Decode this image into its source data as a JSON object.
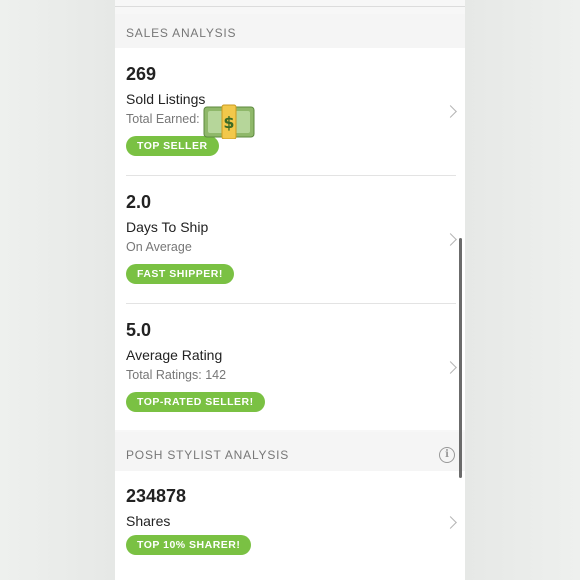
{
  "sales_section": {
    "header": "SALES ANALYSIS",
    "items": [
      {
        "value": "269",
        "title": "Sold Listings",
        "subtitle": "Total Earned:",
        "badge": "TOP SELLER"
      },
      {
        "value": "2.0",
        "title": "Days To Ship",
        "subtitle": "On Average",
        "badge": "FAST SHIPPER!"
      },
      {
        "value": "5.0",
        "title": "Average Rating",
        "subtitle": "Total Ratings: 142",
        "badge": "TOP-RATED SELLER!"
      }
    ]
  },
  "stylist_section": {
    "header": "POSH STYLIST ANALYSIS",
    "items": [
      {
        "value": "234878",
        "title": "Shares",
        "badge": "TOP 10% SHARER!"
      }
    ]
  },
  "icons": {
    "money": "money-with-wings-icon",
    "info": "info-icon",
    "chevron": "chevron-right-icon"
  },
  "colors": {
    "badge_green": "#7ac143",
    "page_bg": "#e9eae9",
    "card_bg": "#ffffff"
  }
}
